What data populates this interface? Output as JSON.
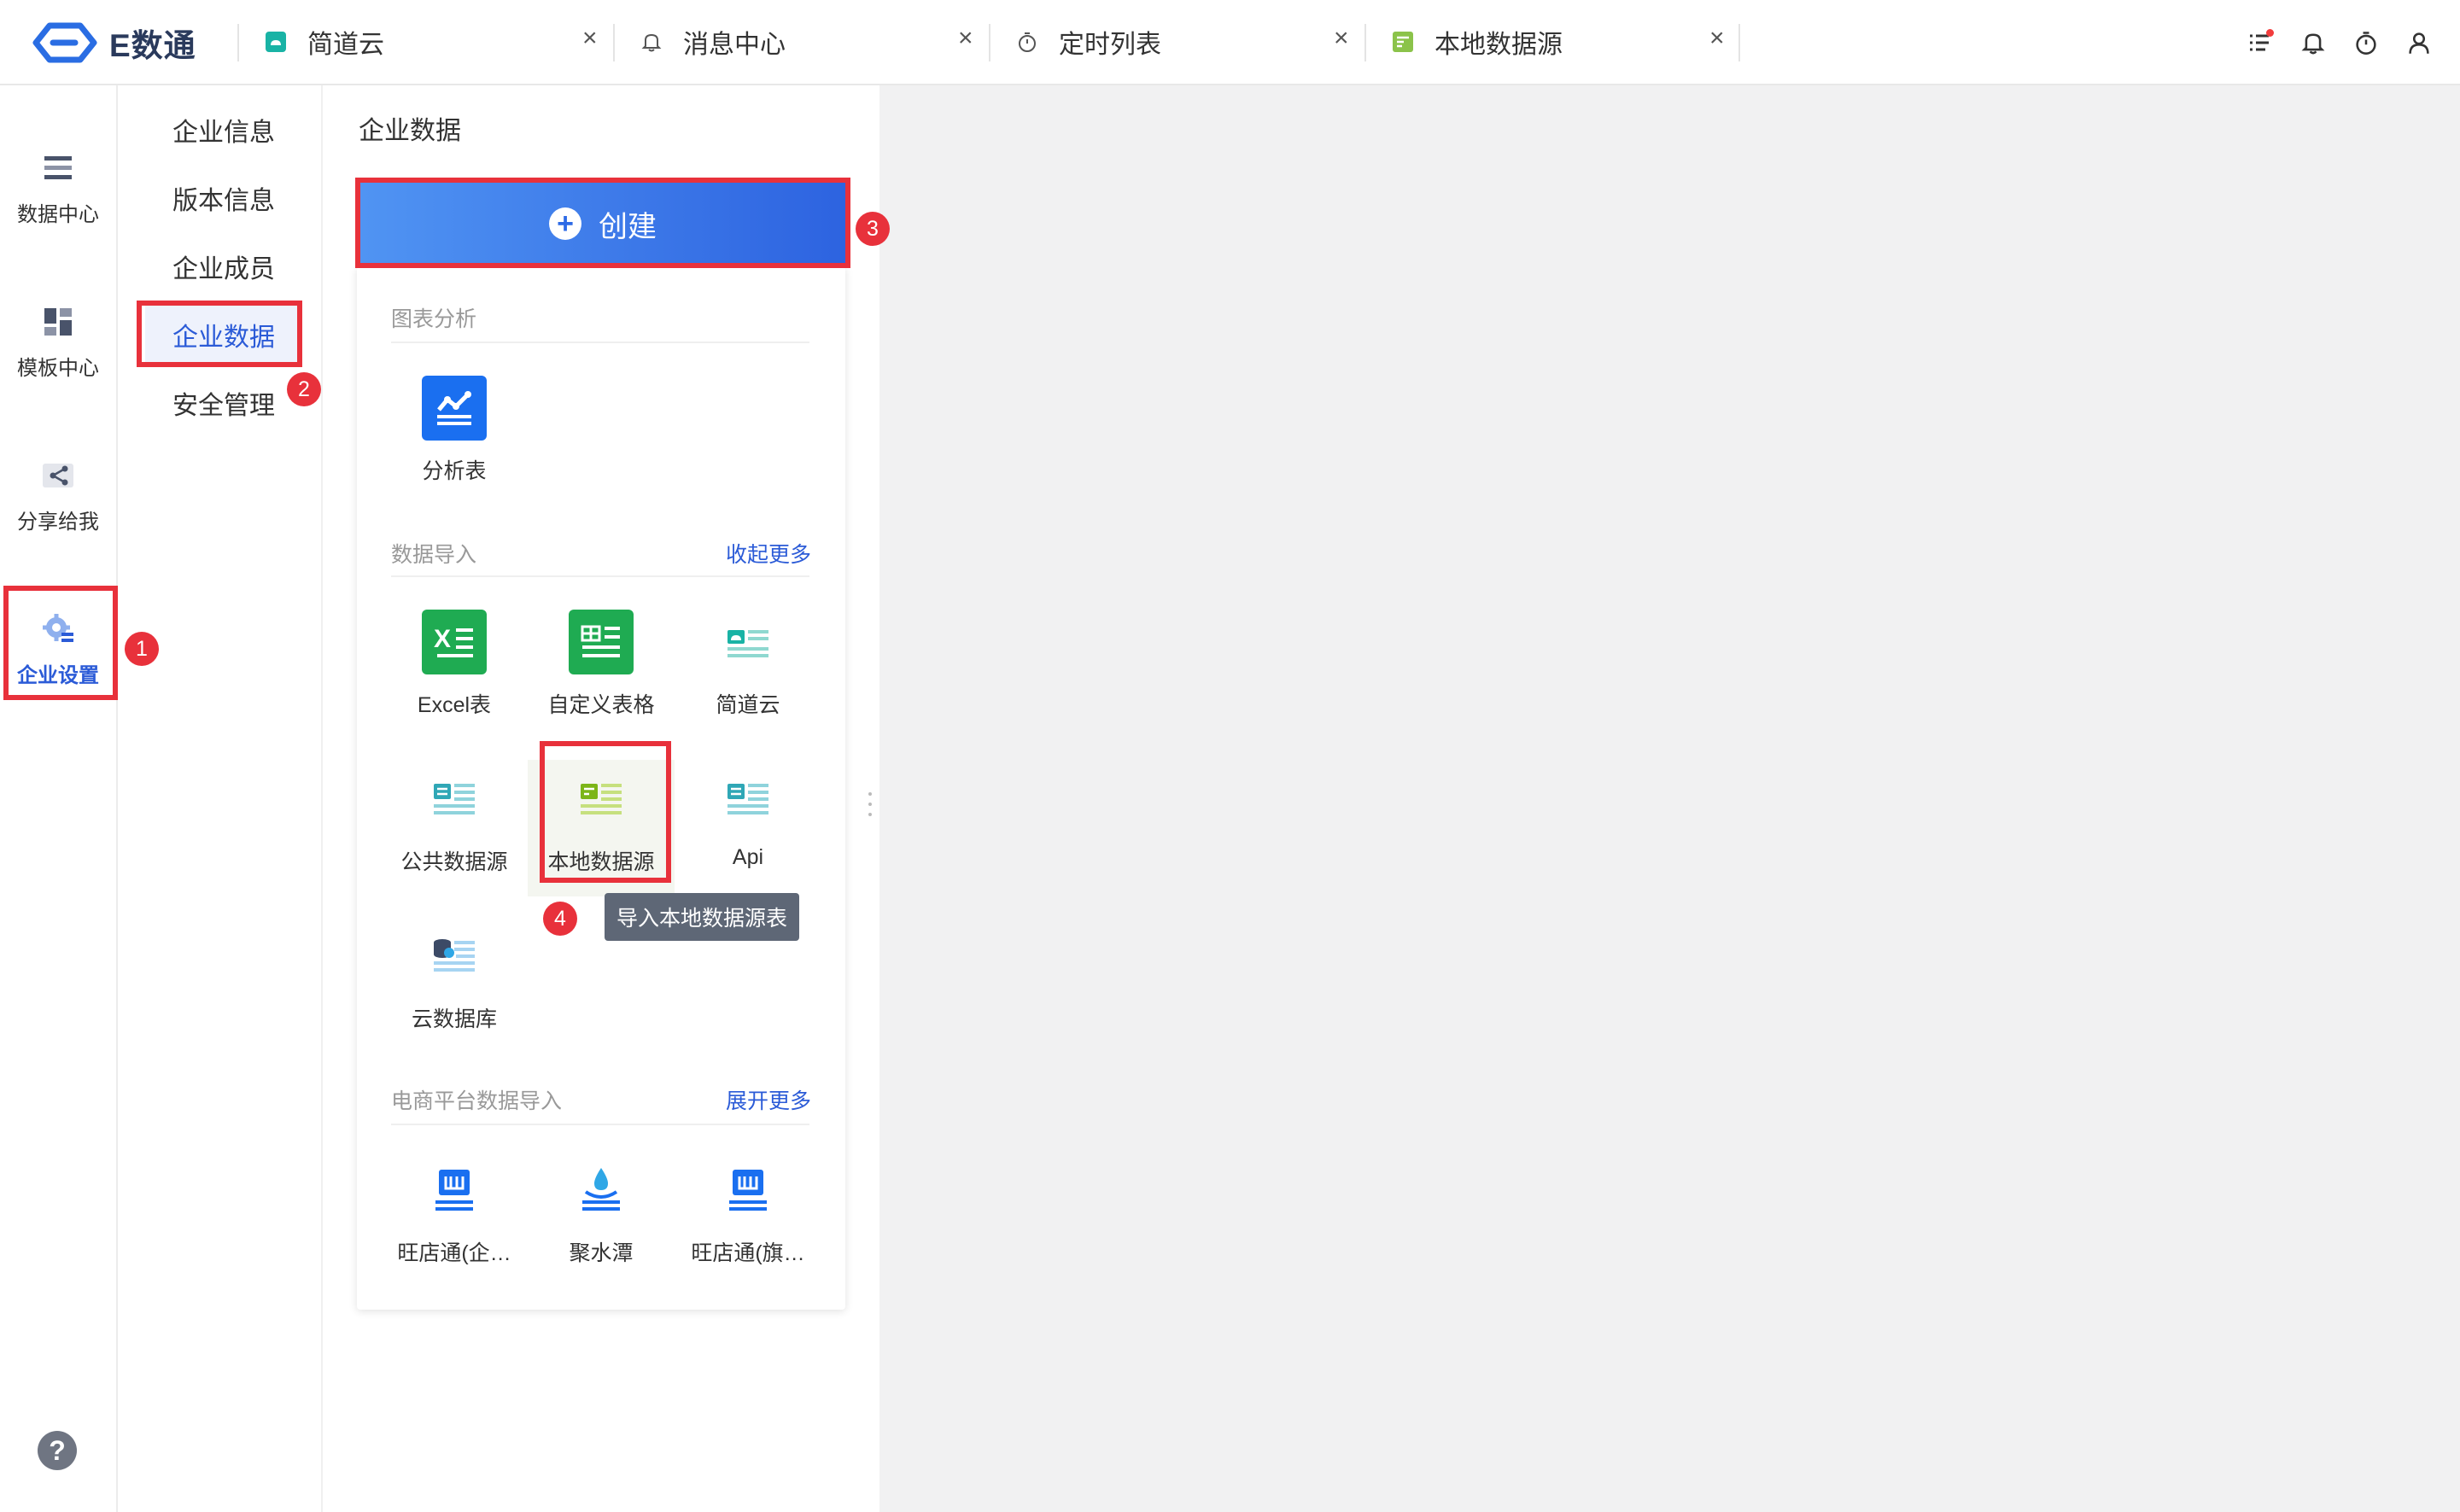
{
  "app": {
    "name": "E数通"
  },
  "tabs": [
    {
      "label": "简道云",
      "icon": "jiandaoyun-icon"
    },
    {
      "label": "消息中心",
      "icon": "bell-icon"
    },
    {
      "label": "定时列表",
      "icon": "timer-icon"
    },
    {
      "label": "本地数据源",
      "icon": "local-datasource-icon"
    }
  ],
  "tab_close": "×",
  "top_icons": [
    "task-list-icon",
    "bell-icon",
    "timer-icon",
    "user-icon"
  ],
  "rail": [
    {
      "label": "数据中心",
      "icon": "data-center-icon"
    },
    {
      "label": "模板中心",
      "icon": "template-icon"
    },
    {
      "label": "分享给我",
      "icon": "share-icon"
    },
    {
      "label": "企业设置",
      "icon": "enterprise-settings-icon",
      "active": true
    }
  ],
  "help": "?",
  "subnav": [
    {
      "label": "企业信息"
    },
    {
      "label": "版本信息"
    },
    {
      "label": "企业成员"
    },
    {
      "label": "企业数据",
      "active": true
    },
    {
      "label": "安全管理"
    }
  ],
  "main": {
    "title": "企业数据",
    "create_button": "创建",
    "plus": "+"
  },
  "dropdown": {
    "chart_group": {
      "title": "图表分析",
      "items": [
        {
          "label": "分析表",
          "icon": "analysis-table-icon"
        }
      ]
    },
    "import_group": {
      "title": "数据导入",
      "link": "收起更多",
      "items": [
        {
          "label": "Excel表",
          "icon": "excel-icon"
        },
        {
          "label": "自定义表格",
          "icon": "custom-table-icon"
        },
        {
          "label": "简道云",
          "icon": "jiandaoyun-icon"
        },
        {
          "label": "公共数据源",
          "icon": "public-datasource-icon"
        },
        {
          "label": "本地数据源",
          "icon": "local-datasource-icon"
        },
        {
          "label": "Api",
          "icon": "api-icon"
        },
        {
          "label": "云数据库",
          "icon": "cloud-database-icon"
        }
      ]
    },
    "ecommerce_group": {
      "title": "电商平台数据导入",
      "link": "展开更多",
      "items": [
        {
          "label": "旺店通(企…",
          "icon": "wangdiantong-icon"
        },
        {
          "label": "聚水潭",
          "icon": "jushuitan-icon"
        },
        {
          "label": "旺店通(旗…",
          "icon": "wangdiantong-icon"
        }
      ]
    }
  },
  "tooltip": "导入本地数据源表",
  "badges": [
    "1",
    "2",
    "3",
    "4"
  ],
  "colors": {
    "accent": "#2b5bd7",
    "annotation": "#e8313b",
    "excel_green": "#1fab52",
    "tooltip_bg": "#5e6776"
  }
}
